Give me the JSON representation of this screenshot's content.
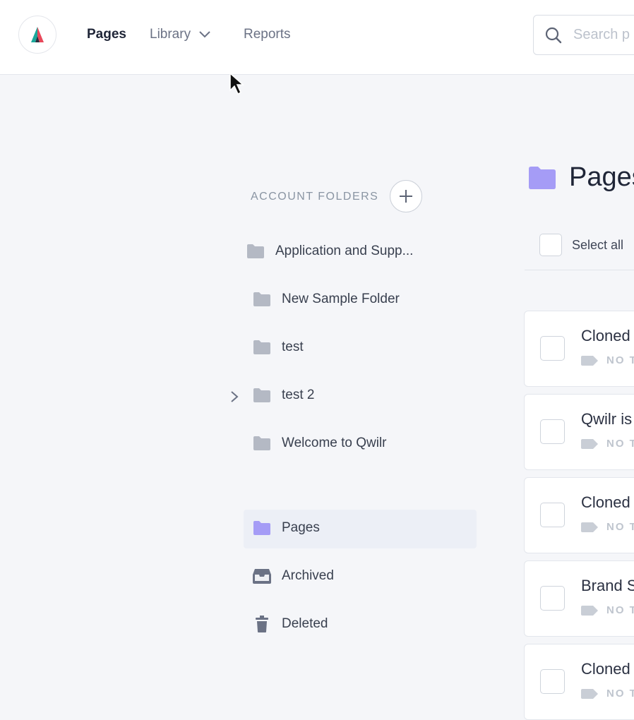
{
  "nav": {
    "pages_label": "Pages",
    "library_label": "Library",
    "reports_label": "Reports"
  },
  "search": {
    "placeholder": "Search p"
  },
  "sidebar": {
    "section_title": "ACCOUNT FOLDERS",
    "folders": [
      {
        "label": "Application and Supp..."
      },
      {
        "label": "New Sample Folder"
      },
      {
        "label": "test"
      },
      {
        "label": "test 2"
      },
      {
        "label": "Welcome to Qwilr"
      }
    ],
    "system": [
      {
        "label": "Pages"
      },
      {
        "label": "Archived"
      },
      {
        "label": "Deleted"
      }
    ]
  },
  "main": {
    "title": "Pages",
    "select_all_label": "Select all",
    "cards": [
      {
        "title": "Cloned",
        "tag": "NO T"
      },
      {
        "title": "Qwilr is",
        "tag": "NO T"
      },
      {
        "title": "Cloned",
        "tag": "NO T"
      },
      {
        "title": "Brand S",
        "tag": "NO T"
      },
      {
        "title": "Cloned",
        "tag": "NO T"
      }
    ]
  },
  "colors": {
    "accent_folder": "#a59cf6",
    "folder_grey": "#b4b9c4",
    "logo_teal": "#1aa89a",
    "logo_red": "#e8485a"
  }
}
